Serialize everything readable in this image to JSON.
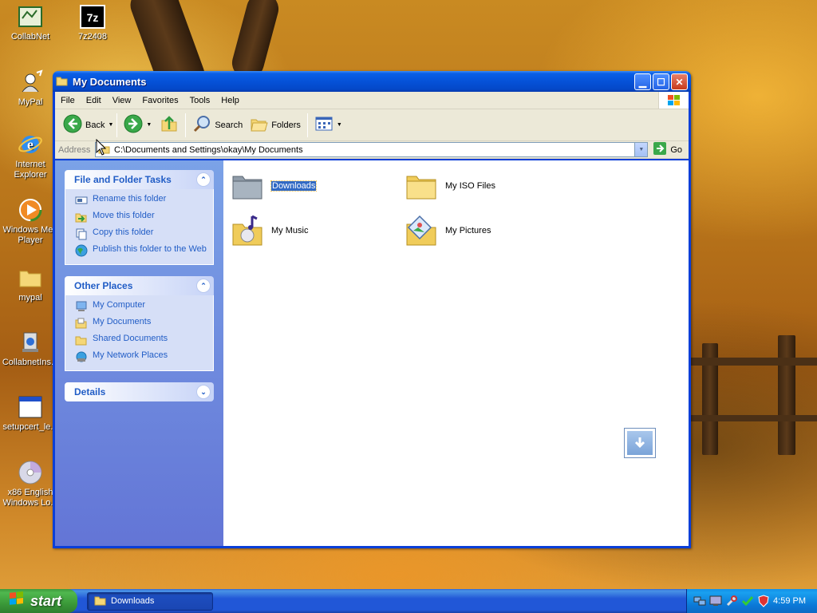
{
  "desktop": {
    "icons": [
      {
        "label": "CollabNet"
      },
      {
        "label": "7z2408"
      },
      {
        "label": "MyPal"
      },
      {
        "label": "Internet Explorer"
      },
      {
        "label": "Windows Med Player"
      },
      {
        "label": "mypal"
      },
      {
        "label": "CollabnetIns..."
      },
      {
        "label": "setupcert_le..."
      },
      {
        "label": "x86 English Windows Lo..."
      }
    ]
  },
  "window": {
    "title": "My Documents",
    "menu": [
      "File",
      "Edit",
      "View",
      "Favorites",
      "Tools",
      "Help"
    ],
    "toolbar": {
      "back_label": "Back",
      "search_label": "Search",
      "folders_label": "Folders"
    },
    "address": {
      "label": "Address",
      "value": "C:\\Documents and Settings\\okay\\My Documents",
      "go_label": "Go"
    },
    "taskpane": {
      "file_tasks": {
        "title": "File and Folder Tasks",
        "items": [
          "Rename this folder",
          "Move this folder",
          "Copy this folder",
          "Publish this folder to the Web"
        ]
      },
      "other_places": {
        "title": "Other Places",
        "items": [
          "My Computer",
          "My Documents",
          "Shared Documents",
          "My Network Places"
        ]
      },
      "details": {
        "title": "Details"
      }
    },
    "files": [
      {
        "name": "Downloads",
        "selected": true
      },
      {
        "name": "My ISO Files",
        "selected": false
      },
      {
        "name": "My Music",
        "selected": false
      },
      {
        "name": "My Pictures",
        "selected": false
      }
    ]
  },
  "taskbar": {
    "start_label": "start",
    "task_label": "Downloads",
    "clock": "4:59 PM"
  }
}
